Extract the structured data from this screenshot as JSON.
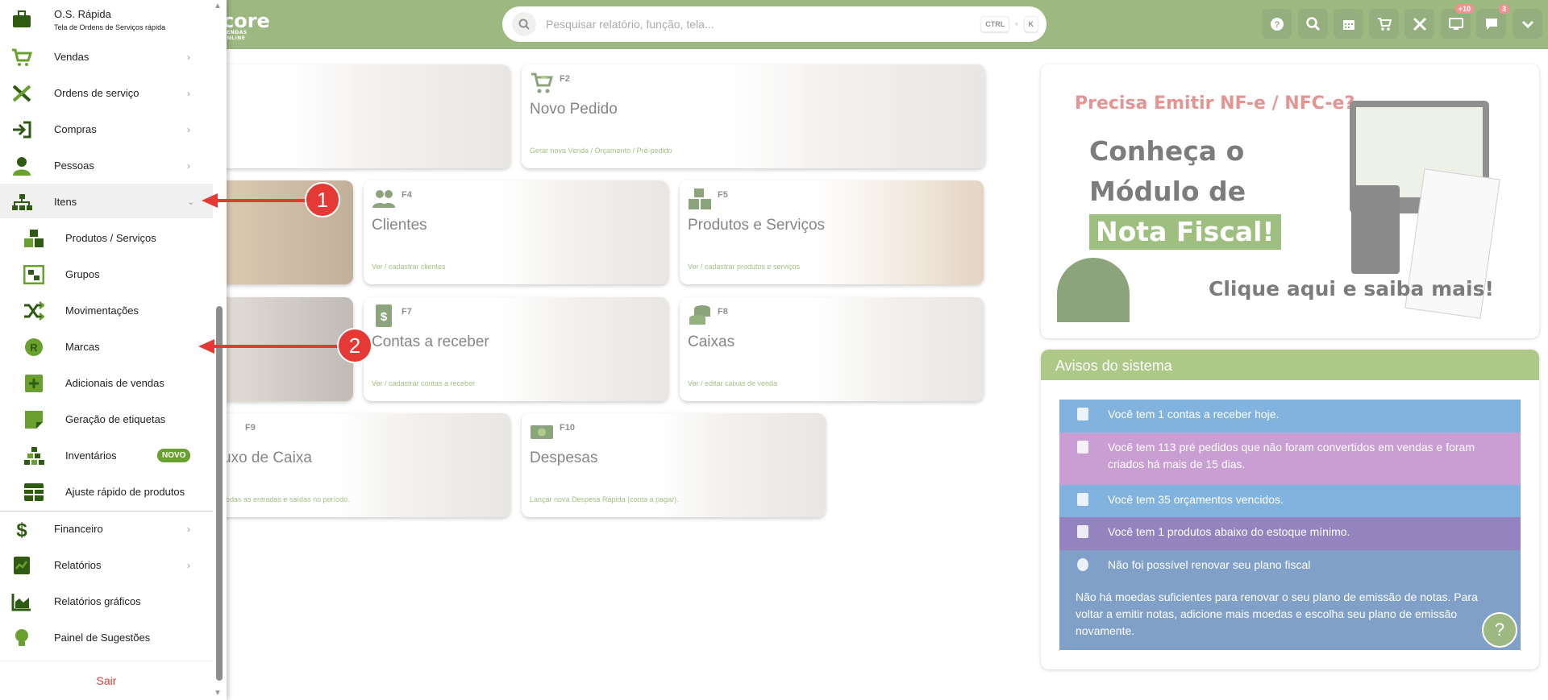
{
  "topbar": {
    "brand": "core",
    "brand_tag": "VENDAS ONLINE",
    "search_placeholder": "Pesquisar relatório, função, tela...",
    "shortcut_key1": "CTRL",
    "shortcut_plus": "+",
    "shortcut_key2": "K",
    "badge_screens": "+10",
    "badge_messages": "3"
  },
  "sidebar": {
    "header_title": "O.S. Rápida",
    "header_sub": "Tela de Ordens de Serviços rápida",
    "items": {
      "vendas": "Vendas",
      "ordens": "Ordens de serviço",
      "compras": "Compras",
      "pessoas": "Pessoas",
      "itens": "Itens",
      "financeiro": "Financeiro",
      "relatorios": "Relatórios",
      "graficos": "Relatórios gráficos",
      "sugestoes": "Painel de Sugestões"
    },
    "itens_sub": {
      "produtos": "Produtos / Serviços",
      "grupos": "Grupos",
      "movimentacoes": "Movimentações",
      "marcas": "Marcas",
      "adicionais": "Adicionais de vendas",
      "etiquetas": "Geração de etiquetas",
      "inventarios": "Inventários",
      "inventarios_badge": "NOVO",
      "ajuste": "Ajuste rápido de produtos"
    },
    "logout": "Sair"
  },
  "cards": {
    "novo_pedido": {
      "key": "F2",
      "title": "Novo Pedido",
      "sub": "Gerar nova Venda / Orçamento / Pré-pedido"
    },
    "clientes": {
      "key": "F4",
      "title": "Clientes",
      "sub": "Ver / cadastrar clientes"
    },
    "produtos": {
      "key": "F5",
      "title": "Produtos e Serviços",
      "sub": "Ver / cadastrar produtos e serviços"
    },
    "contas": {
      "key": "F7",
      "title": "Contas a receber",
      "sub": "Ver / cadastrar contas a receber"
    },
    "caixas": {
      "key": "F8",
      "title": "Caixas",
      "sub": "Ver / editar caixas de venda"
    },
    "fluxo": {
      "key": "F9",
      "title": "uxo de Caixa",
      "sub": "odas as entradas e saídas no período."
    },
    "despesas": {
      "key": "F10",
      "title": "Despesas",
      "sub": "Lançar nova Despesa Rápida (conta a pagar)."
    }
  },
  "promo": {
    "question": "Precisa Emitir NF-e / NFC-e?",
    "line1": "Conheça o",
    "line2": "Módulo de",
    "line3": "Nota Fiscal!",
    "cta": "Clique aqui e saiba mais!"
  },
  "avisos": {
    "title": "Avisos do sistema",
    "a1": "Você tem 1 contas a receber hoje.",
    "a2": "Você tem 113 pré pedidos que não foram convertidos em vendas e foram criados há mais de 15 dias.",
    "a3": "Você tem 35 orçamentos vencidos.",
    "a4": "Você tem 1 produtos abaixo do estoque mínimo.",
    "a5_title": "Não foi possível renovar seu plano fiscal",
    "a5_body": "Não há moedas suficientes para renovar o seu plano de emissão de notas. Para voltar a emitir notas, adicione mais moedas e escolha seu plano de emissão novamente."
  },
  "annotations": {
    "n1": "1",
    "n2": "2"
  },
  "colors": {
    "brand_green": "#4f7f1c",
    "alert_red": "#e53935",
    "aviso_blue": "#1c75c4",
    "aviso_purple": "#9b4fb0",
    "aviso_indigo": "#3b1e8a",
    "aviso_navy": "#19539a"
  }
}
